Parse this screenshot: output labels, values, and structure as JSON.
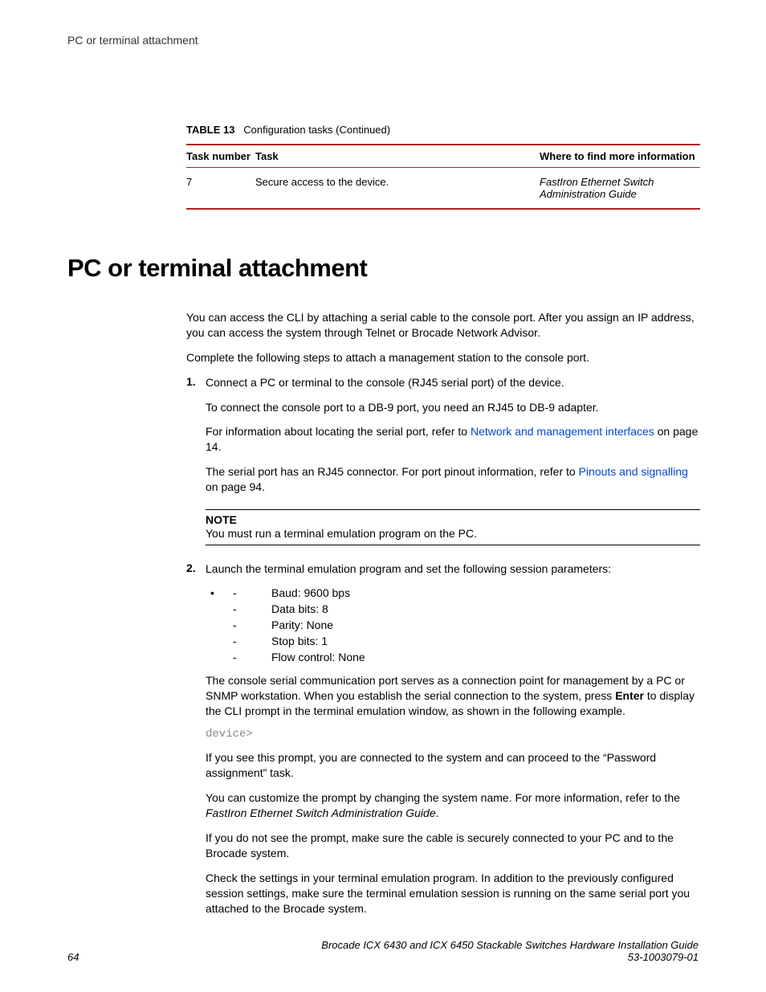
{
  "running_header": "PC or terminal attachment",
  "table": {
    "caption_label": "TABLE 13",
    "caption_text": "Configuration tasks (Continued)",
    "headers": {
      "num": "Task number",
      "task": "Task",
      "where": "Where to find more information"
    },
    "row": {
      "num": "7",
      "task": "Secure access to the device.",
      "where": "FastIron Ethernet Switch Administration Guide"
    }
  },
  "section_title": "PC or terminal attachment",
  "intro": {
    "p1": "You can access the CLI by attaching a serial cable to the console port. After you assign an IP address, you can access the system through Telnet or Brocade Network Advisor.",
    "p2": "Complete the following steps to attach a management station to the console port."
  },
  "step1": {
    "num": "1.",
    "p1": "Connect a PC or terminal to the console (RJ45 serial port) of the device.",
    "p2": "To connect the console port to a DB-9 port, you need an RJ45 to DB-9 adapter.",
    "p3a": "For information about locating the serial port, refer to ",
    "p3link": "Network and management interfaces",
    "p3b": " on page 14.",
    "p4a": "The serial port has an RJ45 connector. For port pinout information, refer to ",
    "p4link": "Pinouts and signalling",
    "p4b": " on page 94."
  },
  "note": {
    "label": "NOTE",
    "body": "You must run a terminal emulation program on the PC."
  },
  "step2": {
    "num": "2.",
    "p1": "Launch the terminal emulation program and set the following session parameters:",
    "params": [
      "Baud: 9600 bps",
      "Data bits: 8",
      "Parity: None",
      "Stop bits: 1",
      "Flow control: None"
    ],
    "p2a": "The console serial communication port serves as a connection point for management by a PC or SNMP workstation. When you establish the serial connection to the system, press ",
    "p2bold": "Enter",
    "p2b": " to display the CLI prompt in the terminal emulation window, as shown in the following example.",
    "code": "device>",
    "p3": "If you see this prompt, you are connected to the system and can proceed to the “Password assignment” task.",
    "p4a": "You can customize the prompt by changing the system name. For more information, refer to the ",
    "p4i": "FastIron Ethernet Switch Administration Guide",
    "p4b": ".",
    "p5": "If you do not see the prompt, make sure the cable is securely connected to your PC and to the Brocade system.",
    "p6": "Check the settings in your terminal emulation program. In addition to the previously configured session settings, make sure the terminal emulation session is running on the same serial port you attached to the Brocade system."
  },
  "footer": {
    "page": "64",
    "pub_title": "Brocade ICX 6430 and ICX 6450 Stackable Switches Hardware Installation Guide",
    "pub_id": "53-1003079-01"
  }
}
